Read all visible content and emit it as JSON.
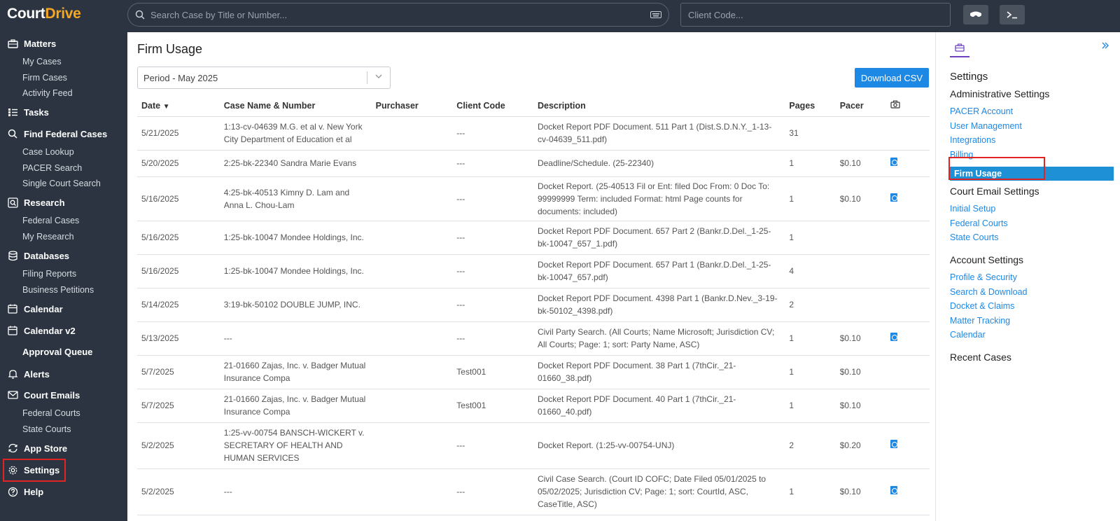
{
  "app": {
    "logo_part1": "Court",
    "logo_part2": "Drive"
  },
  "topbar": {
    "search_placeholder": "Search Case by Title or Number...",
    "client_code_placeholder": "Client Code..."
  },
  "sidebar": {
    "matters": "Matters",
    "my_cases": "My Cases",
    "firm_cases": "Firm Cases",
    "activity_feed": "Activity Feed",
    "tasks": "Tasks",
    "find_federal_cases": "Find Federal Cases",
    "case_lookup": "Case Lookup",
    "pacer_search": "PACER Search",
    "single_court_search": "Single Court Search",
    "research": "Research",
    "federal_cases": "Federal Cases",
    "my_research": "My Research",
    "databases": "Databases",
    "filing_reports": "Filing Reports",
    "business_petitions": "Business Petitions",
    "calendar": "Calendar",
    "calendar_v2": "Calendar v2",
    "approval_queue": "Approval Queue",
    "alerts": "Alerts",
    "court_emails": "Court Emails",
    "federal_courts": "Federal Courts",
    "state_courts": "State Courts",
    "app_store": "App Store",
    "settings": "Settings",
    "help": "Help"
  },
  "main": {
    "title": "Firm Usage",
    "period": "Period - May 2025",
    "download_csv": "Download CSV",
    "columns": {
      "date": "Date",
      "case": "Case Name & Number",
      "purchaser": "Purchaser",
      "client_code": "Client Code",
      "description": "Description",
      "pages": "Pages",
      "pacer": "Pacer"
    },
    "rows": [
      {
        "date": "5/21/2025",
        "case": "1:13-cv-04639 M.G. et al v. New York City Department of Education et al",
        "purchaser": "",
        "code": "---",
        "desc": "Docket Report PDF Document. 511 Part 1 (Dist.S.D.N.Y._1-13-cv-04639_511.pdf)",
        "pages": "31",
        "pacer": "",
        "pdf": false
      },
      {
        "date": "5/20/2025",
        "case": "2:25-bk-22340 Sandra Marie Evans",
        "purchaser": "",
        "code": "---",
        "desc": "Deadline/Schedule. (25-22340)",
        "pages": "1",
        "pacer": "$0.10",
        "pdf": true
      },
      {
        "date": "5/16/2025",
        "case": "4:25-bk-40513 Kimny D. Lam and Anna L. Chou-Lam",
        "purchaser": "",
        "code": "---",
        "desc": "Docket Report. (25-40513 Fil or Ent: filed Doc From: 0 Doc To: 99999999 Term: included Format: html Page counts for documents: included)",
        "pages": "1",
        "pacer": "$0.10",
        "pdf": true
      },
      {
        "date": "5/16/2025",
        "case": "1:25-bk-10047 Mondee Holdings, Inc.",
        "purchaser": "",
        "code": "---",
        "desc": "Docket Report PDF Document. 657 Part 2 (Bankr.D.Del._1-25-bk-10047_657_1.pdf)",
        "pages": "1",
        "pacer": "",
        "pdf": false
      },
      {
        "date": "5/16/2025",
        "case": "1:25-bk-10047 Mondee Holdings, Inc.",
        "purchaser": "",
        "code": "---",
        "desc": "Docket Report PDF Document. 657 Part 1 (Bankr.D.Del._1-25-bk-10047_657.pdf)",
        "pages": "4",
        "pacer": "",
        "pdf": false
      },
      {
        "date": "5/14/2025",
        "case": "3:19-bk-50102 DOUBLE JUMP, INC.",
        "purchaser": "",
        "code": "---",
        "desc": "Docket Report PDF Document. 4398 Part 1 (Bankr.D.Nev._3-19-bk-50102_4398.pdf)",
        "pages": "2",
        "pacer": "",
        "pdf": false
      },
      {
        "date": "5/13/2025",
        "case": "---",
        "purchaser": "",
        "code": "---",
        "desc": "Civil Party Search. (All Courts; Name Microsoft; Jurisdiction CV; All Courts; Page: 1; sort: Party Name, ASC)",
        "pages": "1",
        "pacer": "$0.10",
        "pdf": true
      },
      {
        "date": "5/7/2025",
        "case": "21-01660 Zajas, Inc. v. Badger Mutual Insurance Compa",
        "purchaser": "",
        "code": "Test001",
        "desc": "Docket Report PDF Document. 38 Part 1 (7thCir._21-01660_38.pdf)",
        "pages": "1",
        "pacer": "$0.10",
        "pdf": false
      },
      {
        "date": "5/7/2025",
        "case": "21-01660 Zajas, Inc. v. Badger Mutual Insurance Compa",
        "purchaser": "",
        "code": "Test001",
        "desc": "Docket Report PDF Document. 40 Part 1 (7thCir._21-01660_40.pdf)",
        "pages": "1",
        "pacer": "$0.10",
        "pdf": false
      },
      {
        "date": "5/2/2025",
        "case": "1:25-vv-00754 BANSCH-WICKERT v. SECRETARY OF HEALTH AND HUMAN SERVICES",
        "purchaser": "",
        "code": "---",
        "desc": "Docket Report. (1:25-vv-00754-UNJ)",
        "pages": "2",
        "pacer": "$0.20",
        "pdf": true
      },
      {
        "date": "5/2/2025",
        "case": "---",
        "purchaser": "",
        "code": "---",
        "desc": "Civil Case Search. (Court ID COFC; Date Filed 05/01/2025 to 05/02/2025; Jurisdiction CV; Page: 1; sort: CourtId, ASC, CaseTitle, ASC)",
        "pages": "1",
        "pacer": "$0.10",
        "pdf": true
      }
    ]
  },
  "rpanel": {
    "settings": "Settings",
    "admin_settings": "Administrative Settings",
    "pacer_account": "PACER Account",
    "user_management": "User Management",
    "integrations": "Integrations",
    "billing": "Billing",
    "firm_usage": "Firm Usage",
    "court_email_settings": "Court Email Settings",
    "initial_setup": "Initial Setup",
    "federal_courts": "Federal Courts",
    "state_courts": "State Courts",
    "account_settings": "Account Settings",
    "profile_security": "Profile & Security",
    "search_download": "Search & Download",
    "docket_claims": "Docket & Claims",
    "matter_tracking": "Matter Tracking",
    "calendar": "Calendar",
    "recent_cases": "Recent Cases"
  },
  "colors": {
    "accent": "#1e88e5",
    "sidebar_bg": "#2b3440",
    "logo_accent": "#f5a623",
    "highlight": "#e02424"
  }
}
